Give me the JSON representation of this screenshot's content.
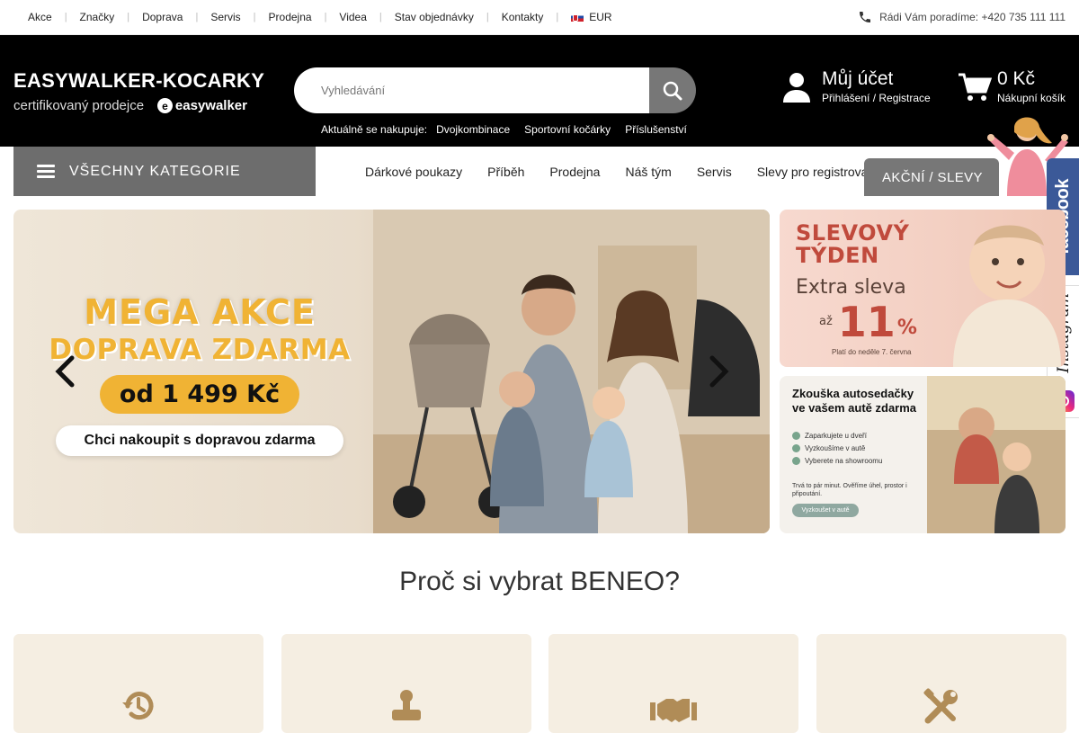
{
  "topbar": {
    "nav": [
      "Akce",
      "Značky",
      "Doprava",
      "Servis",
      "Prodejna",
      "Videa",
      "Stav objednávky",
      "Kontakty"
    ],
    "currency": "EUR",
    "phone_text": "Rádi Vám poradíme: +420 735 111 111"
  },
  "header": {
    "logo_title": "EASYWALKER-KOCARKY",
    "logo_sub": "certifikovaný prodejce",
    "logo_brand": "easywalker",
    "search_placeholder": "Vyhledávání",
    "popular_label": "Aktuálně se nakupuje:",
    "popular": [
      "Dvojkombinace",
      "Sportovní kočárky",
      "Příslušenství"
    ],
    "account_title": "Můj účet",
    "account_sub": "Přihlášení / Registrace",
    "cart_total": "0 Kč",
    "cart_label": "Nákupní košík"
  },
  "catbar": {
    "all_categories": "VŠECHNY KATEGORIE",
    "nav": [
      "Dárkové poukazy",
      "Příběh",
      "Prodejna",
      "Náš tým",
      "Servis",
      "Slevy pro registrova"
    ],
    "sale_button": "AKČNÍ / SLEVY"
  },
  "social": {
    "facebook": "facebook",
    "instagram": "Instagram"
  },
  "hero": {
    "line1": "MEGA AKCE",
    "line2": "DOPRAVA ZDARMA",
    "price": "od 1 499 Kč",
    "cta": "Chci nakoupit s dopravou zdarma"
  },
  "banner1": {
    "title1": "SLEVOVÝ",
    "title2": "TÝDEN",
    "sub": "Extra sleva",
    "prefix": "až",
    "number": "11",
    "percent": "%",
    "note": "Platí do neděle 7. června"
  },
  "banner2": {
    "title1": "Zkouška autosedačky",
    "title2": "ve vašem autě zdarma",
    "steps": [
      "Zaparkujete u dveří",
      "Vyzkoušíme v autě",
      "Vyberete na showroomu"
    ],
    "note": "Trvá to pár minut. Ověříme úhel, prostor i připoutání.",
    "button": "Vyzkoušet v autě"
  },
  "why": {
    "title": "Proč si vybrat BENEO?"
  },
  "colors": {
    "accent": "#f0b334",
    "dark": "#000000",
    "grey_button": "#777777",
    "card_bg": "#f5eee2",
    "card_icon": "#b08c57"
  }
}
